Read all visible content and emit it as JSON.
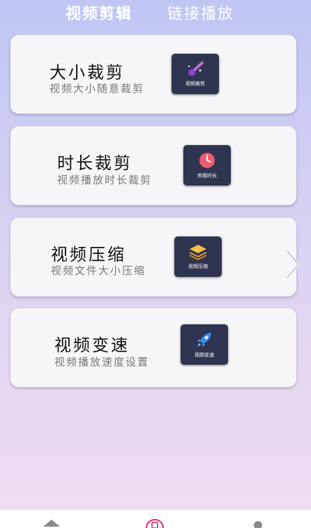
{
  "tabs": [
    "视频剪辑",
    "链接播放"
  ],
  "cards": [
    {
      "title": "大小裁剪",
      "subtitle": "视频大小随意裁剪",
      "icon": "magic-wand-icon",
      "icon_caption": "视频裁剪",
      "icon_color": "#b44fd0"
    },
    {
      "title": "时长裁剪",
      "subtitle": "视频播放时长裁剪",
      "icon": "clock-icon",
      "icon_caption": "剪辑时长",
      "icon_color": "#f05a6e"
    },
    {
      "title": "视频压缩",
      "subtitle": "视频文件大小压缩",
      "icon": "layers-icon",
      "icon_caption": "视频压缩",
      "icon_color": "#f2b134"
    },
    {
      "title": "视频变速",
      "subtitle": "视频播放速度设置",
      "icon": "rocket-icon",
      "icon_caption": "视频变速",
      "icon_color": "#3a8ef0"
    }
  ],
  "bottom_nav": {
    "items": [
      "home-icon",
      "center-badge-icon",
      "profile-icon"
    ],
    "center_color": "#e0286a"
  }
}
